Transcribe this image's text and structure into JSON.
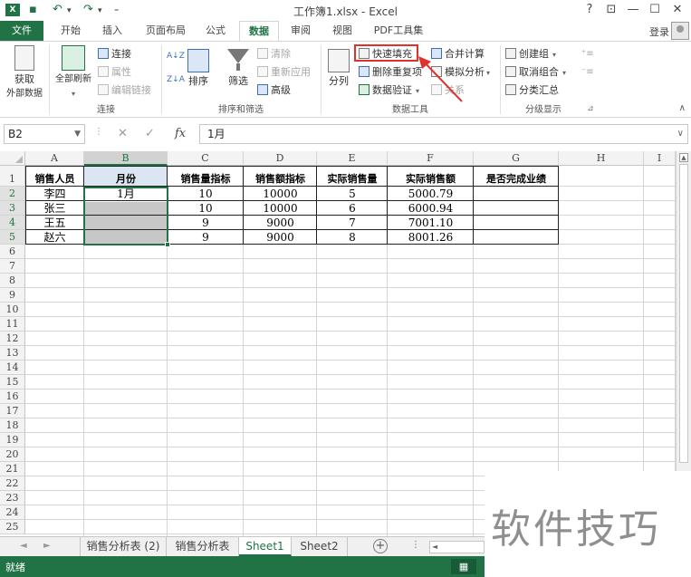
{
  "window": {
    "title": "工作簿1.xlsx - Excel",
    "app_icon": "X",
    "buttons": {
      "help": "?",
      "restore_ribbon": "⊡",
      "minimize": "—",
      "maximize": "☐",
      "close": "✕"
    },
    "quick_access": {
      "save": "💾",
      "undo": "↶",
      "redo": "↷",
      "customize": "₌"
    }
  },
  "ribbon_tabs": [
    {
      "label": "文件"
    },
    {
      "label": "开始"
    },
    {
      "label": "插入"
    },
    {
      "label": "页面布局"
    },
    {
      "label": "公式"
    },
    {
      "label": "数据"
    },
    {
      "label": "审阅"
    },
    {
      "label": "视图"
    },
    {
      "label": "PDF工具集"
    }
  ],
  "active_tab": "数据",
  "login": "登录",
  "ribbon": {
    "get_external_1": "获取",
    "get_external_2": "外部数据",
    "refresh_all": "全部刷新",
    "connections": "连接",
    "properties": "属性",
    "edit_links": "编辑链接",
    "group_connections": "连接",
    "sort_az": "A↓Z",
    "sort_za": "Z↓A",
    "sort": "排序",
    "filter": "筛选",
    "clear": "清除",
    "reapply": "重新应用",
    "advanced": "高级",
    "group_sort_filter": "排序和筛选",
    "text_to_columns": "分列",
    "flash_fill": "快速填充",
    "remove_duplicates": "删除重复项",
    "data_validation": "数据验证",
    "consolidate": "合并计算",
    "what_if": "模拟分析",
    "relationships": "关系",
    "group_data_tools": "数据工具",
    "group": "创建组",
    "ungroup": "取消组合",
    "subtotal": "分类汇总",
    "group_outline": "分级显示"
  },
  "formula_bar": {
    "name_box": "B2",
    "cancel": "✕",
    "enter": "✓",
    "fx": "fx",
    "value": "1月"
  },
  "columns": [
    "A",
    "B",
    "C",
    "D",
    "E",
    "F",
    "G",
    "H",
    "I"
  ],
  "selected_column": "B",
  "rows": [
    "1",
    "2",
    "3",
    "4",
    "5",
    "6",
    "7",
    "8",
    "9",
    "10",
    "11",
    "12",
    "13",
    "14",
    "15",
    "16",
    "17",
    "18",
    "19",
    "20",
    "21",
    "22",
    "23",
    "24",
    "25"
  ],
  "table": {
    "headers": [
      "销售人员",
      "月份",
      "销售量指标",
      "销售额指标",
      "实际销售量",
      "实际销售额",
      "是否完成业绩"
    ],
    "rows": [
      [
        "李四",
        "1月",
        "10",
        "10000",
        "5",
        "5000.79",
        ""
      ],
      [
        "张三",
        "",
        "10",
        "10000",
        "6",
        "6000.94",
        ""
      ],
      [
        "王五",
        "",
        "9",
        "9000",
        "7",
        "7001.10",
        ""
      ],
      [
        "赵六",
        "",
        "9",
        "9000",
        "8",
        "8001.26",
        ""
      ]
    ]
  },
  "sheet_tabs": [
    {
      "label": "销售分析表 (2)"
    },
    {
      "label": "销售分析表"
    },
    {
      "label": "Sheet1"
    },
    {
      "label": "Sheet2"
    }
  ],
  "active_sheet": "Sheet1",
  "status": "就绪",
  "watermark": "软件技巧"
}
